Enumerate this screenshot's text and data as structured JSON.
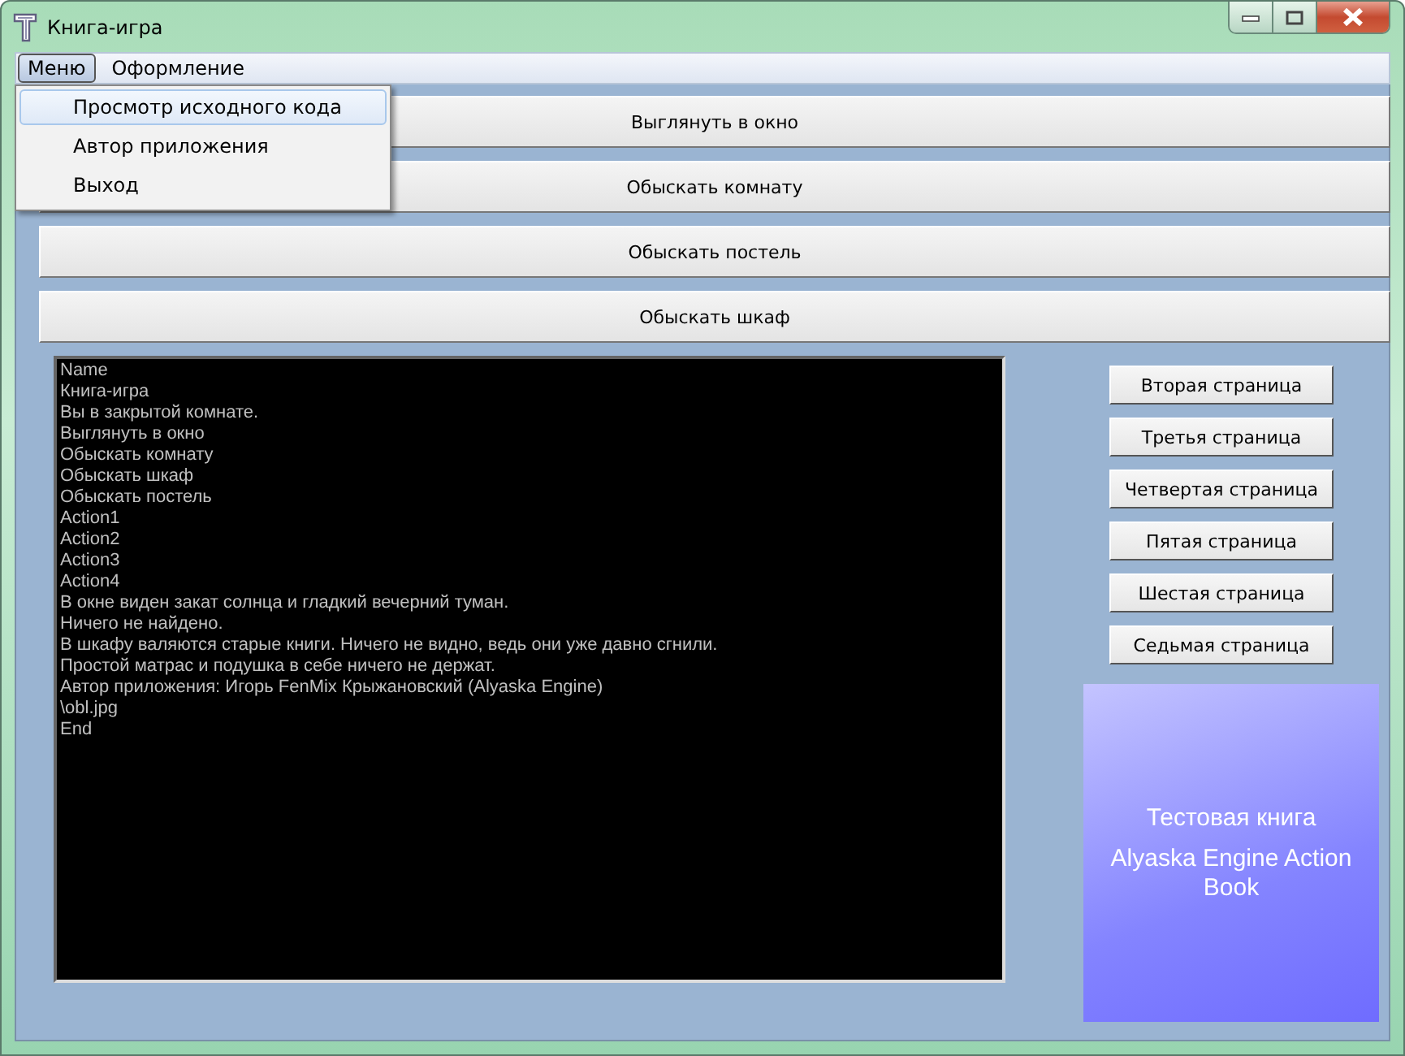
{
  "window": {
    "title": "Книга-игра"
  },
  "menu_bar": [
    {
      "label": "Меню",
      "selected": true
    },
    {
      "label": "Оформление",
      "selected": false
    }
  ],
  "dropdown": [
    {
      "label": "Просмотр исходного кода",
      "selected": true
    },
    {
      "label": "Автор приложения",
      "selected": false
    },
    {
      "label": "Выход",
      "selected": false
    }
  ],
  "action_buttons": [
    "Выглянуть в окно",
    "Обыскать комнату",
    "Обыскать постель",
    "Обыскать шкаф"
  ],
  "source_lines": [
    "Name",
    "Книга-игра",
    "Вы в закрытой комнате.",
    "Выглянуть в окно",
    "Обыскать комнату",
    "Обыскать шкаф",
    "Обыскать постель",
    "Action1",
    "Action2",
    "Action3",
    "Action4",
    "В окне виден закат солнца и гладкий вечерний туман.",
    "Ничего не найдено.",
    "В шкафу валяются старые книги. Ничего не видно, ведь они уже давно сгнили.",
    "Простой матрас и подушка в себе ничего не держат.",
    "Автор приложения: Игорь FenMix Крыжановский (Alyaska Engine)",
    "\\obl.jpg",
    "End"
  ],
  "page_buttons": [
    "Вторая страница",
    "Третья страница",
    "Четвертая страница",
    "Пятая страница",
    "Шестая страница",
    "Седьмая страница"
  ],
  "cover": {
    "title": "Тестовая книга",
    "subtitle": "Alyaska Engine Action Book"
  }
}
